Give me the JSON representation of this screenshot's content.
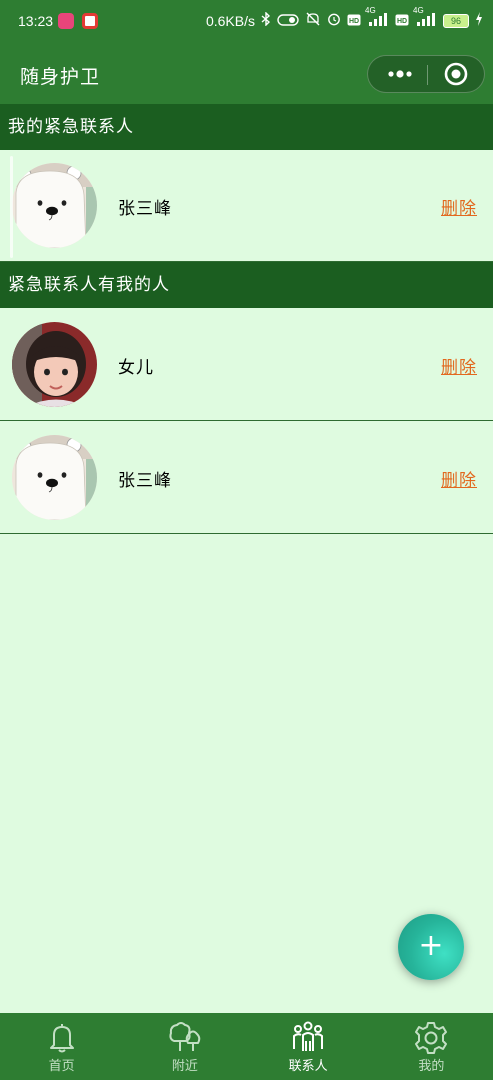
{
  "status_bar": {
    "time": "13:23",
    "network_speed": "0.6KB/s",
    "sim1": "4G",
    "sim2": "4G",
    "battery": "96"
  },
  "nav": {
    "title": "随身护卫",
    "more_icon": "more-dots-icon",
    "close_icon": "target-circle-icon"
  },
  "sections": [
    {
      "title": "我的紧急联系人",
      "contacts": [
        {
          "name": "张三峰",
          "action": "删除",
          "avatar": "polar-bear-avatar"
        }
      ]
    },
    {
      "title": "紧急联系人有我的人",
      "contacts": [
        {
          "name": "女儿",
          "action": "删除",
          "avatar": "child-photo-avatar"
        },
        {
          "name": "张三峰",
          "action": "删除",
          "avatar": "polar-bear-avatar"
        }
      ]
    }
  ],
  "fab": {
    "label": "+"
  },
  "tabs": [
    {
      "label": "首页",
      "icon": "bell-icon",
      "active": false
    },
    {
      "label": "附近",
      "icon": "trees-icon",
      "active": false
    },
    {
      "label": "联系人",
      "icon": "people-icon",
      "active": true
    },
    {
      "label": "我的",
      "icon": "gear-icon",
      "active": false
    }
  ],
  "colors": {
    "header_green": "#2e7d32",
    "section_green": "#1b5e20",
    "background": "#dffbe0",
    "delete_orange": "#e2681e",
    "fab_teal": "#2fc8ab"
  }
}
